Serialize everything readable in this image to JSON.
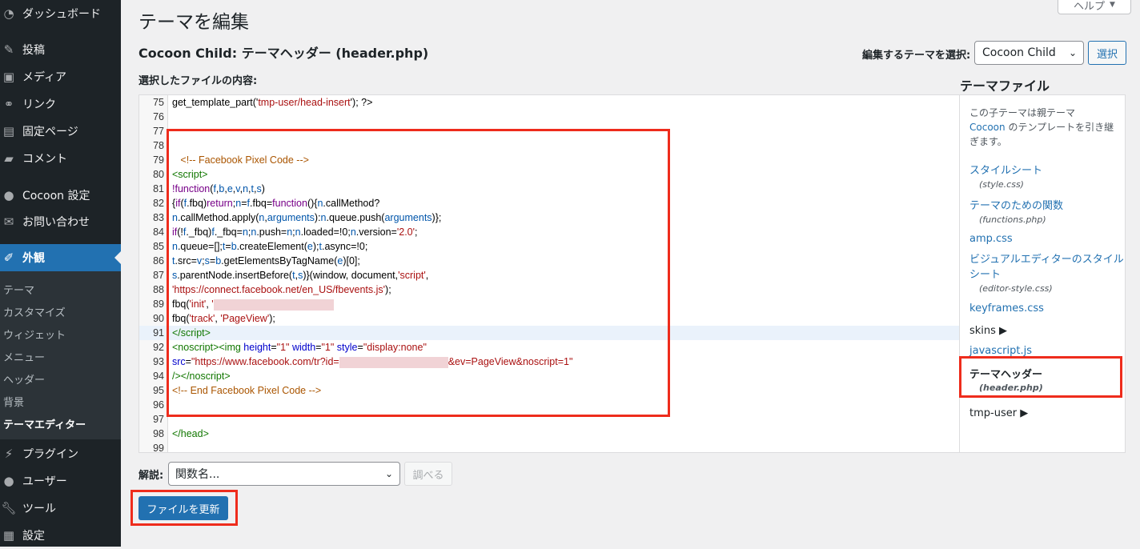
{
  "sidebar": {
    "items": [
      {
        "label": "ダッシュボード",
        "icon": "dashboard-icon"
      },
      {
        "label": "投稿",
        "icon": "pin-icon"
      },
      {
        "label": "メディア",
        "icon": "media-icon"
      },
      {
        "label": "リンク",
        "icon": "link-icon"
      },
      {
        "label": "固定ページ",
        "icon": "page-icon"
      },
      {
        "label": "コメント",
        "icon": "comment-icon"
      },
      {
        "label": "Cocoon 設定",
        "icon": "circle-icon"
      },
      {
        "label": "お問い合わせ",
        "icon": "mail-icon"
      },
      {
        "label": "外観",
        "icon": "brush-icon"
      },
      {
        "label": "プラグイン",
        "icon": "plugin-icon"
      },
      {
        "label": "ユーザー",
        "icon": "user-icon"
      },
      {
        "label": "ツール",
        "icon": "wrench-icon"
      },
      {
        "label": "設定",
        "icon": "settings-icon"
      }
    ],
    "submenu": [
      "テーマ",
      "カスタマイズ",
      "ウィジェット",
      "メニュー",
      "ヘッダー",
      "背景",
      "テーマエディター"
    ]
  },
  "header": {
    "title": "テーマを編集",
    "help_label": "ヘルプ",
    "file_title": "Cocoon Child: テーマヘッダー (header.php)",
    "select_theme_label": "編集するテーマを選択:",
    "selected_theme": "Cocoon Child",
    "select_button": "選択",
    "content_label": "選択したファイルの内容:"
  },
  "editor": {
    "highlight_line": 91,
    "lines": [
      {
        "n": "75",
        "html": "get_template_part('<span class=\"s\">tmp-user/head-insert</span>'); ?>"
      },
      {
        "n": "76",
        "html": ""
      },
      {
        "n": "77",
        "html": ""
      },
      {
        "n": "78",
        "html": ""
      },
      {
        "n": "79",
        "html": "   <span class=\"c\">&lt;!-- Facebook Pixel Code --&gt;</span>"
      },
      {
        "n": "80",
        "html": "<span class=\"tg\">&lt;script&gt;</span>"
      },
      {
        "n": "81",
        "html": "<span class=\"k\">!function</span>(<span class=\"v\">f</span>,<span class=\"v\">b</span>,<span class=\"v\">e</span>,<span class=\"v\">v</span>,<span class=\"v\">n</span>,<span class=\"v\">t</span>,<span class=\"v\">s</span>)"
      },
      {
        "n": "82",
        "html": "{<span class=\"k\">if</span>(<span class=\"v\">f</span>.fbq)<span class=\"k\">return</span>;<span class=\"v\">n</span>=<span class=\"v\">f</span>.fbq=<span class=\"k\">function</span>(){<span class=\"v\">n</span>.callMethod?"
      },
      {
        "n": "83",
        "html": "<span class=\"v\">n</span>.callMethod.apply(<span class=\"v\">n</span>,<span class=\"v\">arguments</span>):<span class=\"v\">n</span>.queue.push(<span class=\"v\">arguments</span>)};"
      },
      {
        "n": "84",
        "html": "<span class=\"k\">if</span>(!<span class=\"v\">f</span>._fbq)<span class=\"v\">f</span>._fbq=<span class=\"v\">n</span>;<span class=\"v\">n</span>.push=<span class=\"v\">n</span>;<span class=\"v\">n</span>.loaded=!0;<span class=\"v\">n</span>.version=<span class=\"s\">'2.0'</span>;"
      },
      {
        "n": "85",
        "html": "<span class=\"v\">n</span>.queue=[];<span class=\"v\">t</span>=<span class=\"v\">b</span>.createElement(<span class=\"v\">e</span>);<span class=\"v\">t</span>.async=!0;"
      },
      {
        "n": "86",
        "html": "<span class=\"v\">t</span>.src=<span class=\"v\">v</span>;<span class=\"v\">s</span>=<span class=\"v\">b</span>.getElementsByTagName(<span class=\"v\">e</span>)[0];"
      },
      {
        "n": "87",
        "html": "<span class=\"v\">s</span>.parentNode.insertBefore(<span class=\"v\">t</span>,<span class=\"v\">s</span>)}(window, document,<span class=\"s\">'script'</span>,"
      },
      {
        "n": "88",
        "html": "<span class=\"s\">'https://connect.facebook.net/en_US/fbevents.js'</span>);"
      },
      {
        "n": "89",
        "html": "fbq(<span class=\"s\">'init'</span>, <span class=\"s\">'</span><span class=\"redact\" style=\"width:150px\"></span>"
      },
      {
        "n": "90",
        "html": "fbq(<span class=\"s\">'track'</span>, <span class=\"s\">'PageView'</span>);"
      },
      {
        "n": "91",
        "html": "<span class=\"tg\">&lt;/script&gt;</span>"
      },
      {
        "n": "92",
        "html": "<span class=\"tg\">&lt;noscript&gt;&lt;img</span> <span class=\"at\">height</span>=<span class=\"s\">\"1\"</span> <span class=\"at\">width</span>=<span class=\"s\">\"1\"</span> <span class=\"at\">style</span>=<span class=\"s\">\"display:none\"</span>"
      },
      {
        "n": "93",
        "html": "<span class=\"at\">src</span>=<span class=\"s\">\"https://www.facebook.com/tr?id=</span><span class=\"redact\" style=\"width:136px\"></span><span class=\"s\">&amp;ev=PageView&amp;noscript=1\"</span>"
      },
      {
        "n": "94",
        "html": "<span class=\"tg\">/&gt;&lt;/noscript&gt;</span>"
      },
      {
        "n": "95",
        "html": "<span class=\"c\">&lt;!-- End Facebook Pixel Code --&gt;</span>"
      },
      {
        "n": "96",
        "html": ""
      },
      {
        "n": "97",
        "html": ""
      },
      {
        "n": "98",
        "html": "<span class=\"tg\">&lt;/head&gt;</span>"
      },
      {
        "n": "99",
        "html": ""
      }
    ]
  },
  "files": {
    "heading": "テーマファイル",
    "desc_pre": "この子テーマは親テーマ",
    "desc_link": "Cocoon",
    "desc_post": "のテンプレートを引き継ぎます。",
    "items": [
      {
        "label": "スタイルシート",
        "sub": "(style.css)"
      },
      {
        "label": "テーマのための関数",
        "sub": "(functions.php)"
      },
      {
        "label": "amp.css"
      },
      {
        "label": "ビジュアルエディターのスタイルシート",
        "sub": "(editor-style.css)"
      },
      {
        "label": "keyframes.css"
      },
      {
        "label": "skins ▶"
      },
      {
        "label": "javascript.js"
      },
      {
        "label": "テーマヘッダー",
        "sub": "(header.php)"
      },
      {
        "label": "tmp-user ▶"
      }
    ]
  },
  "docs": {
    "label": "解説:",
    "placeholder": "関数名...",
    "lookup_button": "調べる"
  },
  "update_button": "ファイルを更新",
  "colors": {
    "accent": "#2271b1",
    "highlight": "#ee2c1c",
    "sidebar": "#1d2327"
  }
}
